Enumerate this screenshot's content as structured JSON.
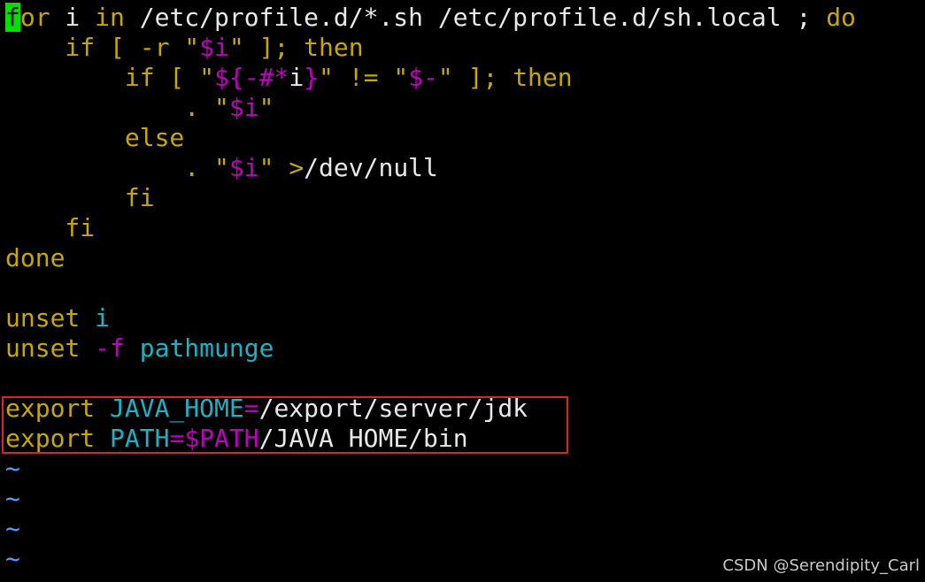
{
  "editor": {
    "lines": [
      {
        "segments": [
          {
            "t": "f",
            "c": "cursor"
          },
          {
            "t": "or",
            "c": "kw"
          },
          {
            "t": " i ",
            "c": "wh"
          },
          {
            "t": "in",
            "c": "kw"
          },
          {
            "t": " /etc/profile.d/*.sh /etc/profile.d/sh.local ; ",
            "c": "wh"
          },
          {
            "t": "do",
            "c": "kw"
          }
        ]
      },
      {
        "segments": [
          {
            "t": "    if [ ",
            "c": "kw"
          },
          {
            "t": "-r",
            "c": "kw"
          },
          {
            "t": " \"",
            "c": "kw"
          },
          {
            "t": "$i",
            "c": "mg"
          },
          {
            "t": "\" ]; then",
            "c": "kw"
          }
        ]
      },
      {
        "segments": [
          {
            "t": "        if [ ",
            "c": "kw"
          },
          {
            "t": "\"",
            "c": "kw"
          },
          {
            "t": "${-#*",
            "c": "mg"
          },
          {
            "t": "i",
            "c": "wh"
          },
          {
            "t": "}",
            "c": "mg"
          },
          {
            "t": "\" != \"",
            "c": "kw"
          },
          {
            "t": "$-",
            "c": "mg"
          },
          {
            "t": "\" ]; then",
            "c": "kw"
          }
        ]
      },
      {
        "segments": [
          {
            "t": "            . ",
            "c": "kw"
          },
          {
            "t": "\"",
            "c": "kw"
          },
          {
            "t": "$i",
            "c": "mg"
          },
          {
            "t": "\"",
            "c": "kw"
          }
        ]
      },
      {
        "segments": [
          {
            "t": "        else",
            "c": "kw"
          }
        ]
      },
      {
        "segments": [
          {
            "t": "            . ",
            "c": "kw"
          },
          {
            "t": "\"",
            "c": "kw"
          },
          {
            "t": "$i",
            "c": "mg"
          },
          {
            "t": "\" ",
            "c": "kw"
          },
          {
            "t": ">",
            "c": "kw"
          },
          {
            "t": "/dev/null",
            "c": "wh"
          }
        ]
      },
      {
        "segments": [
          {
            "t": "        fi",
            "c": "kw"
          }
        ]
      },
      {
        "segments": [
          {
            "t": "    fi",
            "c": "kw"
          }
        ]
      },
      {
        "segments": [
          {
            "t": "done",
            "c": "kw"
          }
        ]
      },
      {
        "segments": []
      },
      {
        "segments": [
          {
            "t": "unset",
            "c": "kw"
          },
          {
            "t": " ",
            "c": "wh"
          },
          {
            "t": "i",
            "c": "cy"
          }
        ]
      },
      {
        "segments": [
          {
            "t": "unset",
            "c": "kw"
          },
          {
            "t": " ",
            "c": "wh"
          },
          {
            "t": "-f",
            "c": "mg"
          },
          {
            "t": " ",
            "c": "wh"
          },
          {
            "t": "pathmunge",
            "c": "cy"
          }
        ]
      },
      {
        "segments": []
      },
      {
        "segments": [
          {
            "t": "export",
            "c": "kw"
          },
          {
            "t": " ",
            "c": "wh"
          },
          {
            "t": "JAVA_HOME",
            "c": "cy"
          },
          {
            "t": "=",
            "c": "mg"
          },
          {
            "t": "/export/server/jdk",
            "c": "wh"
          }
        ]
      },
      {
        "segments": [
          {
            "t": "export",
            "c": "kw"
          },
          {
            "t": " ",
            "c": "wh"
          },
          {
            "t": "PATH",
            "c": "cy"
          },
          {
            "t": "=",
            "c": "mg"
          },
          {
            "t": "$PATH",
            "c": "mg"
          },
          {
            "t": "/JAVA HOME/bin",
            "c": "wh"
          }
        ]
      },
      {
        "segments": [
          {
            "t": "~",
            "c": "tilde"
          }
        ]
      },
      {
        "segments": [
          {
            "t": "~",
            "c": "tilde"
          }
        ]
      },
      {
        "segments": [
          {
            "t": "~",
            "c": "tilde"
          }
        ]
      },
      {
        "segments": [
          {
            "t": "~",
            "c": "tilde"
          }
        ]
      }
    ]
  },
  "watermark": "CSDN @Serendipity_Carl",
  "colors": {
    "background": "#000000",
    "keyword": "#c8a800",
    "identifier": "#1ab2c4",
    "special": "#c000c0",
    "text": "#e8e8e8",
    "tilde": "#4aa3ff",
    "cursor": "#00e000",
    "highlight_box": "#e0202a"
  }
}
